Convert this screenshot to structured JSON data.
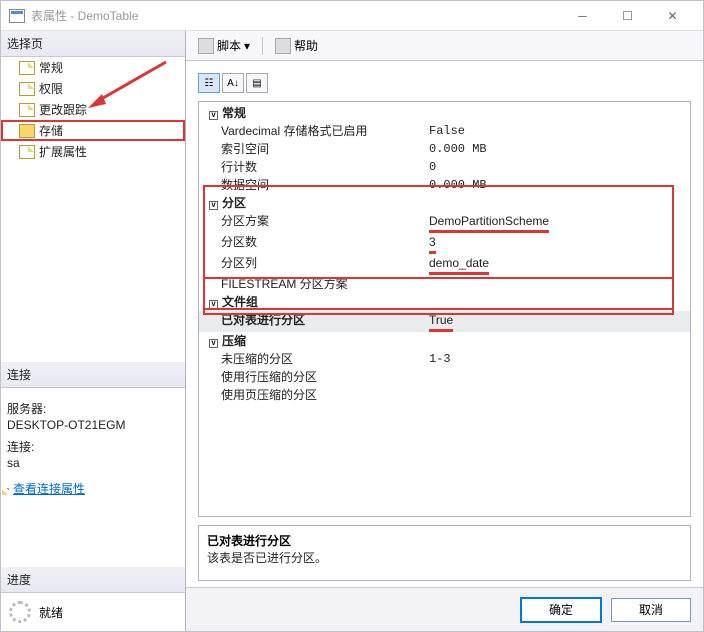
{
  "titlebar": {
    "title": "表属性 - DemoTable"
  },
  "left": {
    "select_page_header": "选择页",
    "items": [
      {
        "label": "常规"
      },
      {
        "label": "权限"
      },
      {
        "label": "更改跟踪"
      },
      {
        "label": "存储"
      },
      {
        "label": "扩展属性"
      }
    ],
    "connection_header": "连接",
    "server_label": "服务器:",
    "server_value": "DESKTOP-OT21EGM",
    "conn_label": "连接:",
    "conn_value": "sa",
    "view_conn_link": "查看连接属性",
    "progress_header": "进度",
    "ready_label": "就绪"
  },
  "toolbar": {
    "script_label": "脚本",
    "help_label": "帮助"
  },
  "grid": {
    "categories": [
      {
        "name": "常规",
        "rows": [
          {
            "k": "Vardecimal 存储格式已启用",
            "v": "False"
          },
          {
            "k": "索引空间",
            "v": "0.000 MB"
          },
          {
            "k": "行计数",
            "v": "0"
          },
          {
            "k": "数据空间",
            "v": "0.000 MB"
          }
        ]
      },
      {
        "name": "分区",
        "rows": [
          {
            "k": "分区方案",
            "v": "DemoPartitionScheme",
            "redUnderline": true
          },
          {
            "k": "分区数",
            "v": "3",
            "redUnderline": true
          },
          {
            "k": "分区列",
            "v": "demo_date",
            "redUnderline": true
          },
          {
            "k": "FILESTREAM 分区方案",
            "v": ""
          }
        ]
      },
      {
        "name": "文件组",
        "rows": [
          {
            "k": "已对表进行分区",
            "v": "True",
            "redUnderline": true,
            "selected": true
          }
        ]
      },
      {
        "name": "压缩",
        "rows": [
          {
            "k": "未压缩的分区",
            "v": "1-3"
          },
          {
            "k": "使用行压缩的分区",
            "v": ""
          },
          {
            "k": "使用页压缩的分区",
            "v": ""
          }
        ]
      }
    ]
  },
  "desc": {
    "title": "已对表进行分区",
    "body": "该表是否已进行分区。"
  },
  "footer": {
    "ok": "确定",
    "cancel": "取消"
  }
}
